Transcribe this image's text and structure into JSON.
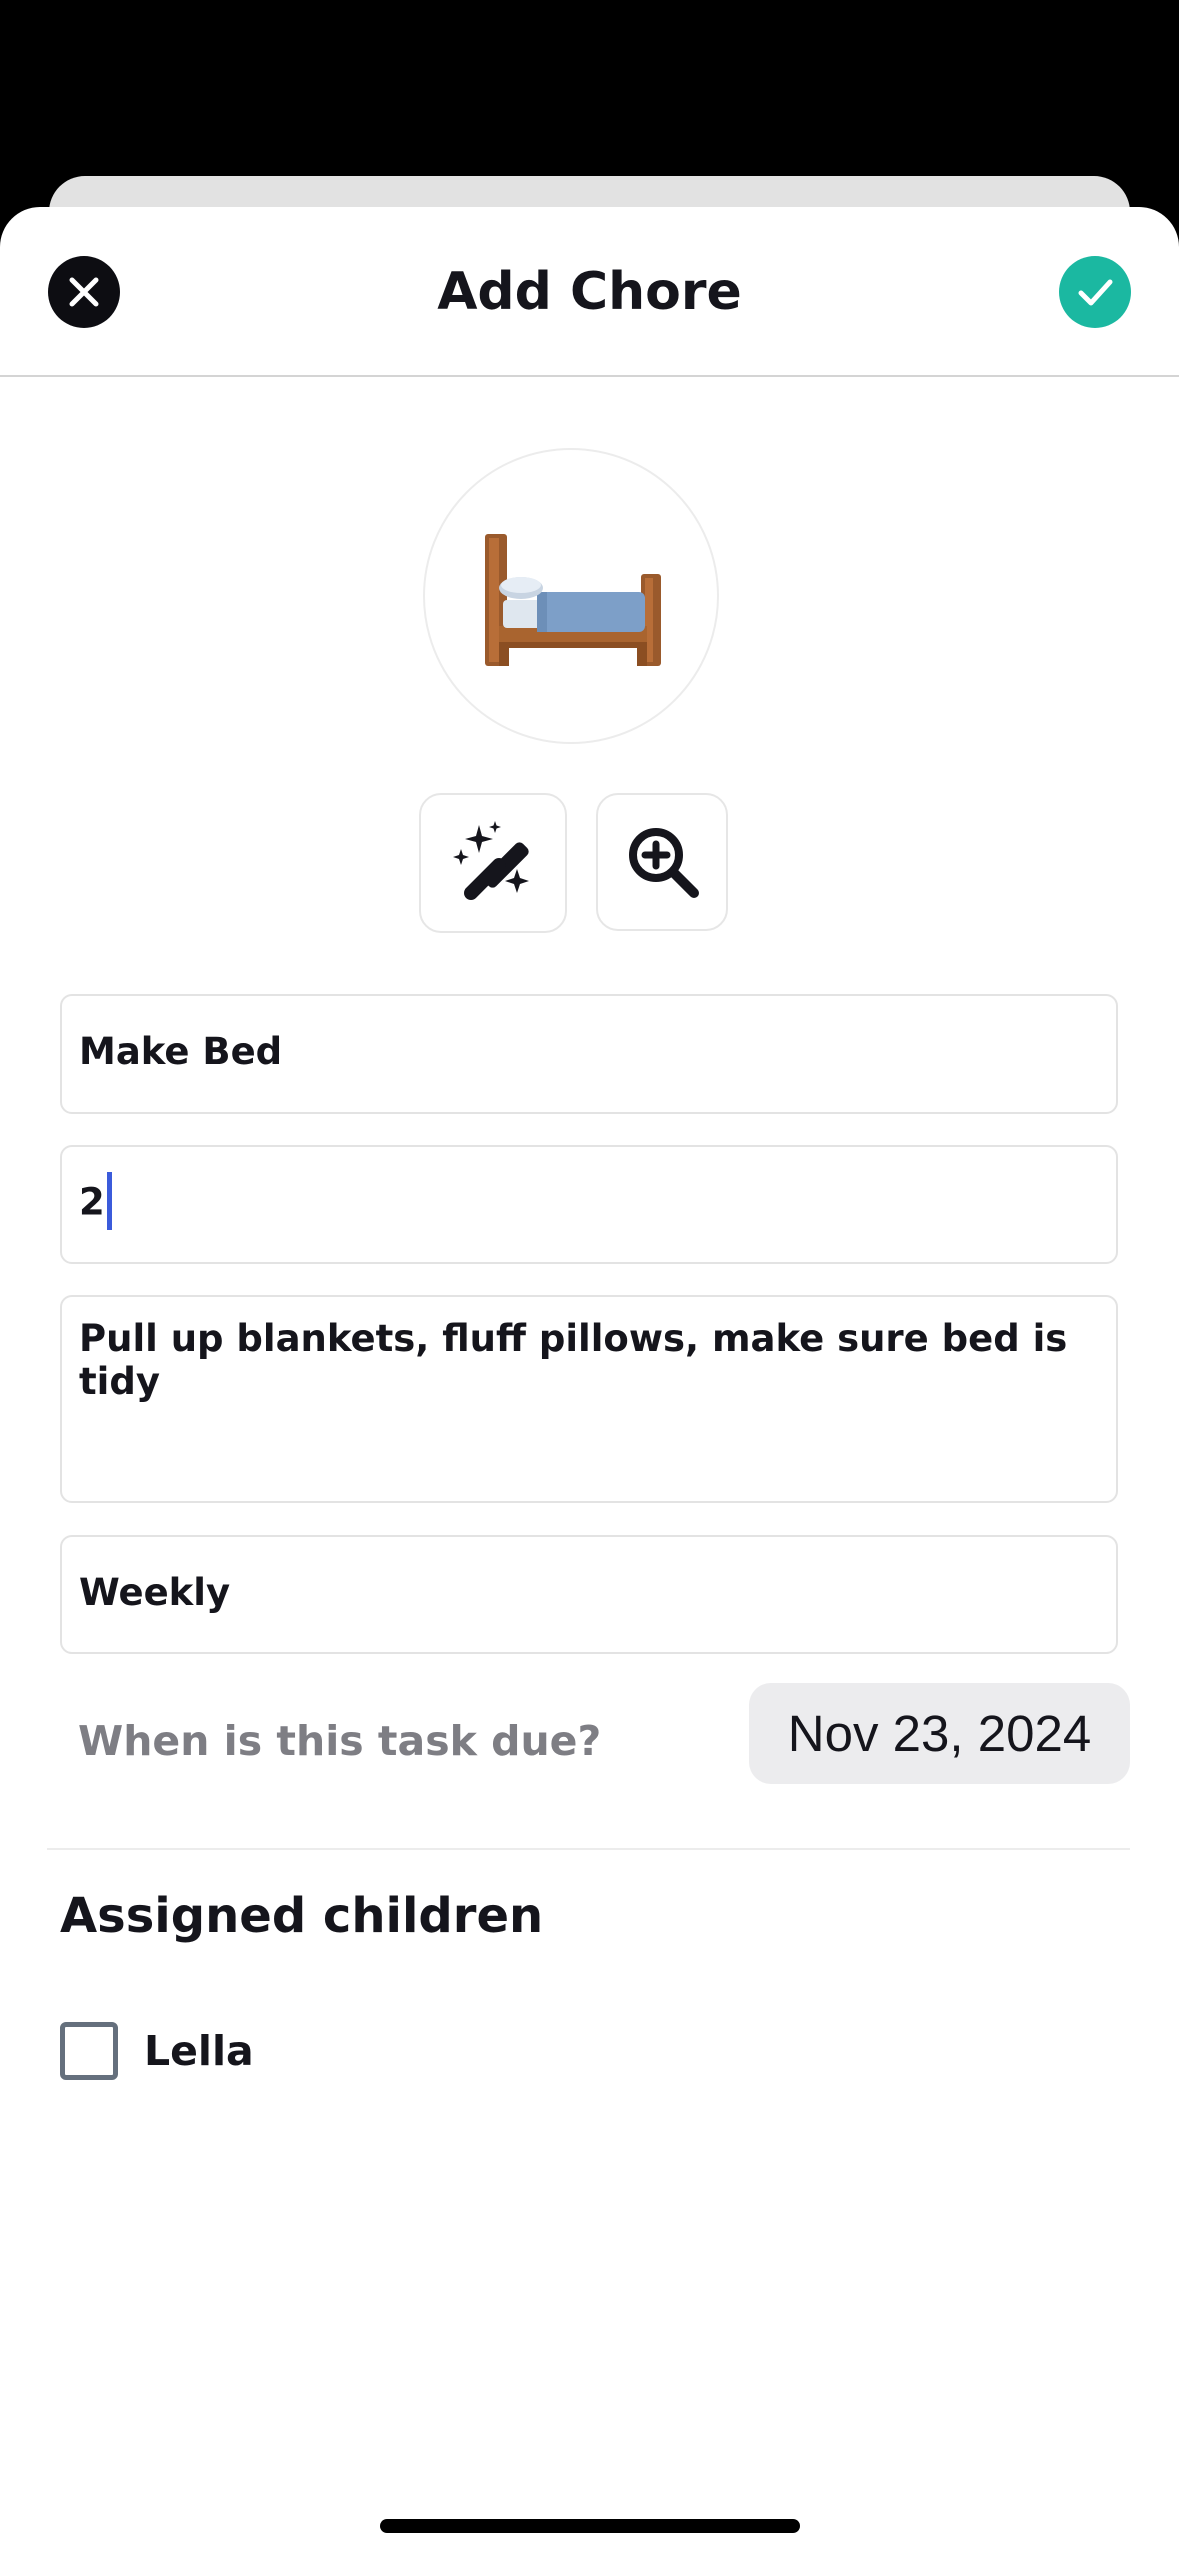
{
  "header": {
    "title": "Add Chore",
    "close_icon": "close-icon",
    "confirm_icon": "checkmark-icon",
    "confirm_color": "#1bb8a1"
  },
  "chore_icon": {
    "emoji": "bed",
    "tools": [
      "magic-wand-icon",
      "zoom-in-icon"
    ]
  },
  "form": {
    "name_value": "Make Bed",
    "points_value": "2",
    "description_value": "Pull up blankets, fluff pillows, make sure bed is tidy",
    "frequency_value": "Weekly",
    "due_label": "When is this task due?",
    "due_date": "Nov 23, 2024"
  },
  "assigned": {
    "title": "Assigned children",
    "children": [
      {
        "name": "Lella",
        "checked": false
      }
    ]
  }
}
